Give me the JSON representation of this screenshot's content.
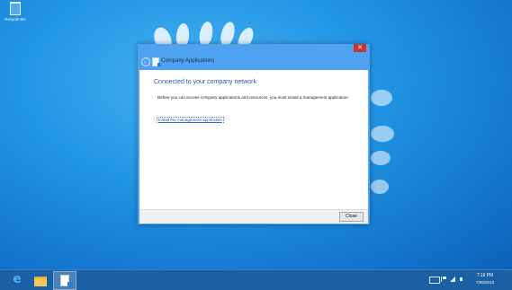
{
  "desktop": {
    "recycle_bin_label": "Recycle Bin"
  },
  "window": {
    "close_glyph": "✕",
    "back_glyph": "←",
    "title": "Company Applications",
    "heading": "Connected to your company network",
    "description": "Before you can access company applications and resources, you must install a management application.",
    "install_link": "Install the management application",
    "close_button": "Close"
  },
  "taskbar": {
    "items": [
      {
        "name": "Internet Explorer",
        "icon": "ie-icon"
      },
      {
        "name": "File Explorer",
        "icon": "folder-icon"
      },
      {
        "name": "Company Applications",
        "icon": "app-icon"
      }
    ],
    "clock_time": "7:16 PM",
    "clock_date": "7/05/2013"
  },
  "colors": {
    "accent": "#4ea2f0",
    "taskbar": "#1b5fa4",
    "close": "#c7372f",
    "heading": "#1e5ea8"
  }
}
